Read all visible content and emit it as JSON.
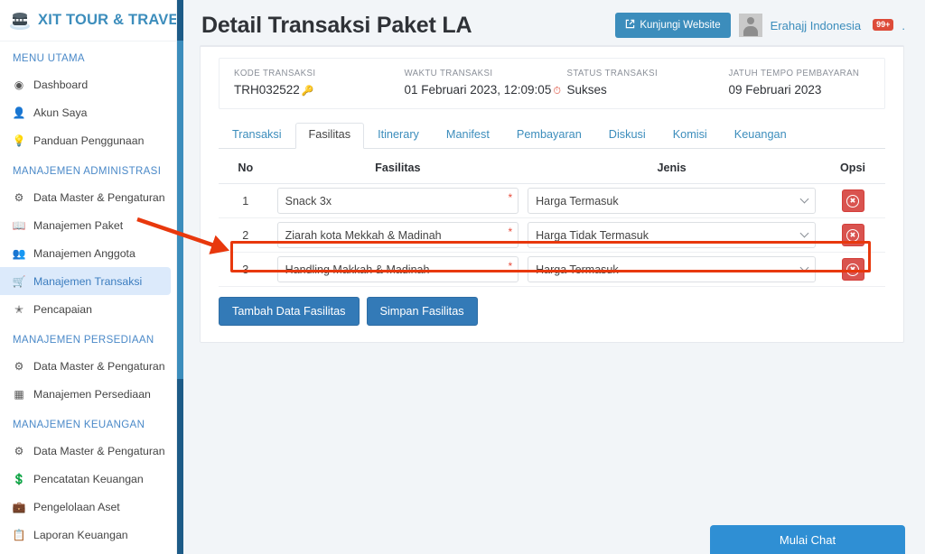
{
  "sidebar": {
    "brand": "XIT TOUR & TRAVEL",
    "logo_icon": "kaaba-logo-icon",
    "sections": [
      {
        "header": "MENU UTAMA",
        "items": [
          {
            "label": "Dashboard",
            "icon": "globe-icon",
            "active": false
          },
          {
            "label": "Akun Saya",
            "icon": "user-icon",
            "active": false
          },
          {
            "label": "Panduan Penggunaan",
            "icon": "lightbulb-icon",
            "active": false
          }
        ]
      },
      {
        "header": "MANAJEMEN ADMINISTRASI",
        "items": [
          {
            "label": "Data Master & Pengaturan",
            "icon": "gears-icon",
            "active": false
          },
          {
            "label": "Manajemen Paket",
            "icon": "book-icon",
            "active": false
          },
          {
            "label": "Manajemen Anggota",
            "icon": "users-icon",
            "active": false
          },
          {
            "label": "Manajemen Transaksi",
            "icon": "cart-icon",
            "active": true
          },
          {
            "label": "Pencapaian",
            "icon": "star-icon",
            "active": false
          }
        ]
      },
      {
        "header": "MANAJEMEN PERSEDIAAN",
        "items": [
          {
            "label": "Data Master & Pengaturan",
            "icon": "gears-icon",
            "active": false
          },
          {
            "label": "Manajemen Persediaan",
            "icon": "boxes-icon",
            "active": false
          }
        ]
      },
      {
        "header": "MANAJEMEN KEUANGAN",
        "items": [
          {
            "label": "Data Master & Pengaturan",
            "icon": "gears-icon",
            "active": false
          },
          {
            "label": "Pencatatan Keuangan",
            "icon": "money-icon",
            "active": false
          },
          {
            "label": "Pengelolaan Aset",
            "icon": "briefcase-icon",
            "active": false
          },
          {
            "label": "Laporan Keuangan",
            "icon": "report-icon",
            "active": false
          }
        ]
      }
    ]
  },
  "topbar": {
    "page_title": "Detail Transaksi Paket LA",
    "visit_button": "Kunjungi Website",
    "visit_icon": "external-link-icon",
    "avatar_icon": "avatar-placeholder-icon",
    "user_name": "Erahajj Indonesia",
    "notification_badge": "99+",
    "trailing_dot": "."
  },
  "info": {
    "fields": [
      {
        "label": "KODE TRANSAKSI",
        "value": "TRH032522",
        "icon": "key-icon"
      },
      {
        "label": "WAKTU TRANSAKSI",
        "value": "01 Februari 2023, 12:09:05",
        "icon": "clock-icon"
      },
      {
        "label": "STATUS TRANSAKSI",
        "value": "Sukses",
        "icon": ""
      },
      {
        "label": "JATUH TEMPO PEMBAYARAN",
        "value": "09 Februari 2023",
        "icon": ""
      }
    ]
  },
  "tabs": [
    {
      "label": "Transaksi",
      "active": false
    },
    {
      "label": "Fasilitas",
      "active": true
    },
    {
      "label": "Itinerary",
      "active": false
    },
    {
      "label": "Manifest",
      "active": false
    },
    {
      "label": "Pembayaran",
      "active": false
    },
    {
      "label": "Diskusi",
      "active": false
    },
    {
      "label": "Komisi",
      "active": false
    },
    {
      "label": "Keuangan",
      "active": false
    }
  ],
  "table": {
    "columns": [
      "No",
      "Fasilitas",
      "Jenis",
      "Opsi"
    ],
    "required_marker": "*",
    "delete_icon": "circle-x-icon",
    "jenis_options": [
      "Harga Termasuk",
      "Harga Tidak Termasuk"
    ],
    "rows": [
      {
        "no": "1",
        "fasilitas": "Snack 3x",
        "jenis": "Harga Termasuk",
        "highlighted": false
      },
      {
        "no": "2",
        "fasilitas": "Ziarah kota Mekkah & Madinah",
        "jenis": "Harga Tidak Termasuk",
        "highlighted": false
      },
      {
        "no": "3",
        "fasilitas": "Handling Makkah & Madinah",
        "jenis": "Harga Termasuk",
        "highlighted": true
      }
    ]
  },
  "actions": {
    "add_button": "Tambah Data Fasilitas",
    "save_button": "Simpan Fasilitas"
  },
  "chat": {
    "label": "Mulai Chat"
  },
  "annotation": {
    "arrow_color": "#e8380d",
    "highlight_color": "#e8380d",
    "arrow_target": "row-3-fasilitas"
  },
  "colors": {
    "brand_blue": "#3c8dbc",
    "primary_button": "#337ab7",
    "danger": "#d9534f",
    "sidebar_bg": "#ffffff",
    "content_bg": "#f2f5f8"
  }
}
